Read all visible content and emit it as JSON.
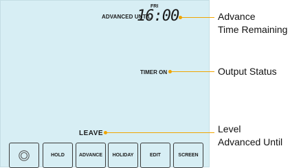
{
  "display": {
    "advanced_until_label": "ADVANCED UNTIL",
    "day": "FRI",
    "time": "16:00",
    "output_status": "TIMER ON",
    "level": "LEAVE"
  },
  "buttons": [
    {
      "label": "",
      "icon": "power-icon"
    },
    {
      "label": "HOLD"
    },
    {
      "label": "ADVANCE"
    },
    {
      "label": "HOLIDAY"
    },
    {
      "label": "EDIT"
    },
    {
      "label": "SCREEN"
    }
  ],
  "callouts": {
    "advance_line1": "Advance",
    "advance_line2": "Time Remaining",
    "output": "Output Status",
    "level_line1": "Level",
    "level_line2": "Advanced Until"
  },
  "colors": {
    "screen_bg": "#d7eef4",
    "accent": "#f0a500"
  }
}
